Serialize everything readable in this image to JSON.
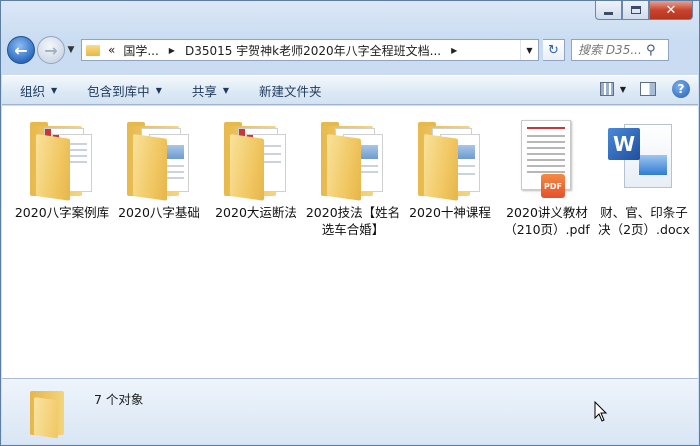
{
  "titlebar": {
    "close_glyph": "✕"
  },
  "navbar": {
    "back_glyph": "←",
    "forward_glyph": "→",
    "crumbs": [
      {
        "label": "«",
        "arrow": ""
      },
      {
        "label": "国学...",
        "arrow": "▶"
      },
      {
        "label": "D35015 宇贺神k老师2020年八字全程班文档...",
        "arrow": "▶"
      }
    ],
    "search_placeholder": "搜索 D35...",
    "refresh_glyph": "↻"
  },
  "toolbar": {
    "organize": "组织",
    "include_library": "包含到库中",
    "share": "共享",
    "new_folder": "新建文件夹"
  },
  "files": [
    {
      "label": "2020八字案例库",
      "type": "folder"
    },
    {
      "label": "2020八字基础",
      "type": "folder"
    },
    {
      "label": "2020大运断法",
      "type": "folder"
    },
    {
      "label": "2020技法【姓名选车合婚】",
      "type": "folder"
    },
    {
      "label": "2020十神课程",
      "type": "folder"
    },
    {
      "label": "2020讲义教材（210页）.pdf",
      "type": "pdf",
      "badge": "PDF"
    },
    {
      "label": "财、官、印条子决（2页）.docx",
      "type": "docx",
      "badge": "W"
    }
  ],
  "status": {
    "count_text": "7 个对象"
  },
  "colors": {
    "accent": "#2c6cc0",
    "folder": "#f1c863",
    "pdf": "#e5502a",
    "word": "#1f4f9e"
  }
}
